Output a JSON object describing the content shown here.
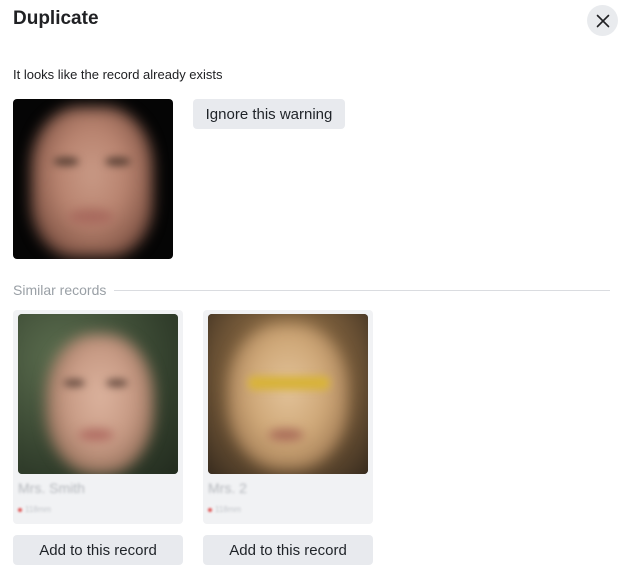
{
  "dialog": {
    "title": "Duplicate",
    "close_icon": "close-icon",
    "message": "It looks like the record already exists",
    "ignore_label": "Ignore this warning",
    "similar_label": "Similar records"
  },
  "similar_records": [
    {
      "name": "Mrs. Smith",
      "meta": "118mm",
      "add_label": "Add to this record"
    },
    {
      "name": "Mrs. 2",
      "meta": "118mm",
      "add_label": "Add to this record"
    }
  ],
  "colors": {
    "button_bg": "#e8eaee",
    "card_bg": "#f1f2f4",
    "divider": "#dadce0",
    "muted_text": "#9aa0a6"
  }
}
